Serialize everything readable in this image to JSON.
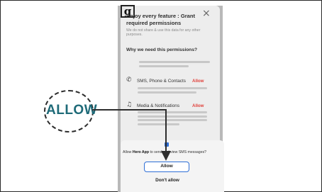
{
  "step": {
    "badge": "g"
  },
  "sheet": {
    "title": "Enjoy every feature : Grant required permissions",
    "subtitle": "We do not share & use this data for any other purposes.",
    "section_heading": "Why we need this permissions?",
    "permissions": [
      {
        "icon": "phone-icon",
        "label": "SMS, Phone & Contacts",
        "action": "Allow"
      },
      {
        "icon": "notification-icon",
        "label": "Media & Notifications",
        "action": "Allow"
      }
    ]
  },
  "dialog": {
    "message_prefix": "Allow",
    "app_name": "Hero App",
    "message_suffix": "to send and view SMS messages?",
    "allow_label": "Allow",
    "deny_label": "Don't allow"
  },
  "callout": {
    "label": "ALLOW"
  },
  "colors": {
    "accent": "#2f6fd6",
    "allow_text": "#e0413b",
    "callout_text": "#1e6a78"
  }
}
